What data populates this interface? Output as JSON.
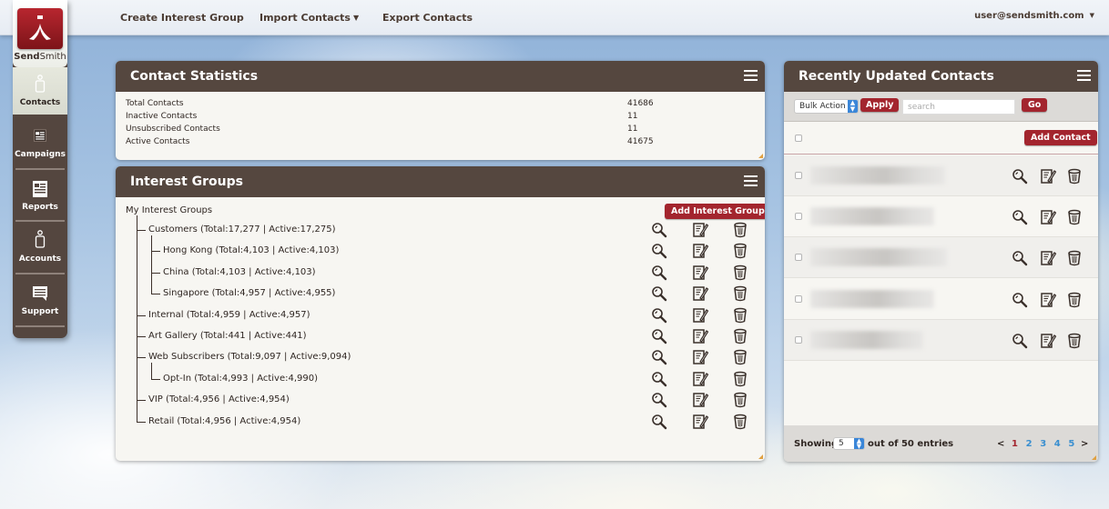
{
  "app": {
    "brand_bold": "Send",
    "brand_light": "Smith"
  },
  "topbar": {
    "nav": [
      {
        "label": "Create Interest Group"
      },
      {
        "label": "Import Contacts",
        "has_dropdown": true
      },
      {
        "label": "Export Contacts"
      }
    ],
    "user": "user@sendsmith.com"
  },
  "sidebar": {
    "items": [
      {
        "label": "Contacts",
        "icon": "person-icon",
        "active": true
      },
      {
        "label": "Campaigns",
        "icon": "newsletter-icon"
      },
      {
        "label": "Reports",
        "icon": "report-icon"
      },
      {
        "label": "Accounts",
        "icon": "person-icon"
      },
      {
        "label": "Support",
        "icon": "chat-icon"
      }
    ]
  },
  "contact_statistics": {
    "title": "Contact Statistics",
    "rows": [
      {
        "label": "Total Contacts",
        "value": "41686"
      },
      {
        "label": "Inactive Contacts",
        "value": "11"
      },
      {
        "label": "Unsubscribed Contacts",
        "value": "11"
      },
      {
        "label": "Active Contacts",
        "value": "41675"
      }
    ]
  },
  "interest_groups": {
    "title": "Interest Groups",
    "root_label": "My Interest Groups",
    "add_button": "Add Interest Group",
    "groups": [
      {
        "label": "Customers (Total:17,277 | Active:17,275)",
        "level": 1
      },
      {
        "label": "Hong Kong (Total:4,103 | Active:4,103)",
        "level": 2
      },
      {
        "label": "China (Total:4,103 | Active:4,103)",
        "level": 2
      },
      {
        "label": "Singapore (Total:4,957 | Active:4,955)",
        "level": 2
      },
      {
        "label": "Internal (Total:4,959 | Active:4,957)",
        "level": 1
      },
      {
        "label": "Art Gallery (Total:441 | Active:441)",
        "level": 1
      },
      {
        "label": "Web Subscribers (Total:9,097 | Active:9,094)",
        "level": 1
      },
      {
        "label": "Opt-In (Total:4,993 | Active:4,990)",
        "level": 2
      },
      {
        "label": "VIP (Total:4,956 | Active:4,954)",
        "level": 1
      },
      {
        "label": "Retail (Total:4,956 | Active:4,954)",
        "level": 1
      }
    ]
  },
  "recent_contacts": {
    "title": "Recently Updated Contacts",
    "bulk_action": "Bulk Action",
    "apply_label": "Apply",
    "search_placeholder": "search",
    "search_value": "",
    "go_label": "Go",
    "add_contact_label": "Add Contact",
    "rows_count": 5,
    "footer": {
      "showing_label": "Showing",
      "page_size": "5",
      "entries_text": "out of 50 entries",
      "prev": "<",
      "next": ">",
      "pages": [
        "1",
        "2",
        "3",
        "4",
        "5"
      ],
      "current_page": "1"
    }
  },
  "colors": {
    "header_brown": "#55473f",
    "accent_red": "#a3252e",
    "link_blue": "#3a8fd0"
  }
}
